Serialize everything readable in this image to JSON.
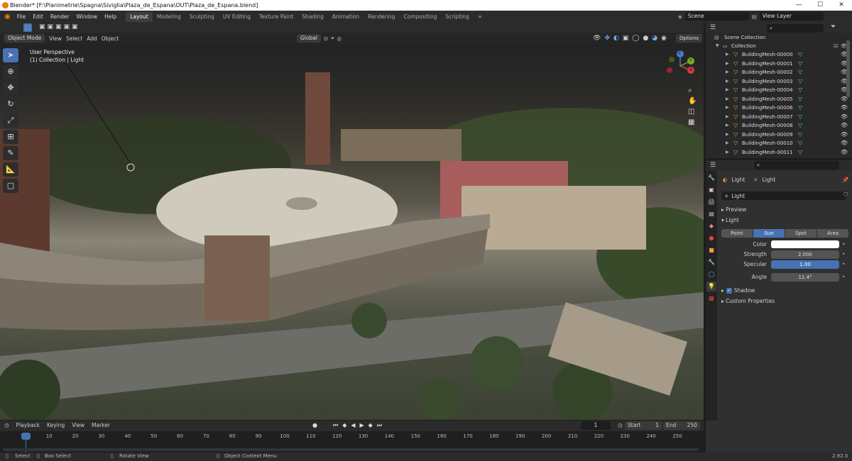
{
  "window": {
    "title": "Blender* [F:\\Planimetrie\\Spagna\\Siviglia\\Plaza_de_Espana\\OUT\\Plaza_de_Espana.blend]",
    "minimize": "—",
    "maximize": "☐",
    "close": "✕"
  },
  "menu": [
    "File",
    "Edit",
    "Render",
    "Window",
    "Help"
  ],
  "workspaces": [
    "Layout",
    "Modeling",
    "Sculpting",
    "UV Editing",
    "Texture Paint",
    "Shading",
    "Animation",
    "Rendering",
    "Compositing",
    "Scripting",
    "+"
  ],
  "scene": {
    "label": "Scene",
    "view_layer": "View Layer"
  },
  "viewport_header": {
    "mode": "Object Mode",
    "items": [
      "View",
      "Select",
      "Add",
      "Object"
    ],
    "orientation": "Global",
    "options": "Options"
  },
  "viewport": {
    "perspective": "User Perspective",
    "context": "(1) Collection | Light"
  },
  "gizmo": {
    "x": "X",
    "y": "Y",
    "z": "Z"
  },
  "outliner": {
    "scene_collection": "Scene Collection",
    "collection": "Collection",
    "items": [
      "BuildingMesh-00000",
      "BuildingMesh-00001",
      "BuildingMesh-00002",
      "BuildingMesh-00003",
      "BuildingMesh-00004",
      "BuildingMesh-00005",
      "BuildingMesh-00006",
      "BuildingMesh-00007",
      "BuildingMesh-00008",
      "BuildingMesh-00009",
      "BuildingMesh-00010",
      "BuildingMesh-00011"
    ]
  },
  "properties": {
    "breadcrumb_obj": "Light",
    "breadcrumb_data": "Light",
    "data_name": "Light",
    "panels": {
      "preview": "Preview",
      "light": "Light",
      "shadow": "Shadow",
      "custom": "Custom Properties"
    },
    "light_types": [
      "Point",
      "Sun",
      "Spot",
      "Area"
    ],
    "active_type": "Sun",
    "color_label": "Color",
    "color_value": "#ffffff",
    "strength_label": "Strength",
    "strength": "2.000",
    "specular_label": "Specular",
    "specular": "1.00",
    "angle_label": "Angle",
    "angle": "11.4°"
  },
  "timeline": {
    "menu": [
      "Playback",
      "Keying",
      "View",
      "Marker"
    ],
    "current_frame": "1",
    "start_label": "Start",
    "start": "1",
    "end_label": "End",
    "end": "250",
    "ticks": [
      "1",
      "10",
      "20",
      "30",
      "40",
      "50",
      "60",
      "70",
      "80",
      "90",
      "100",
      "110",
      "120",
      "130",
      "140",
      "150",
      "160",
      "170",
      "180",
      "190",
      "200",
      "210",
      "220",
      "230",
      "240",
      "250"
    ]
  },
  "status": {
    "select": "Select",
    "box_select": "Box Select",
    "rotate": "Rotate View",
    "context_menu": "Object Context Menu",
    "version": "2.92.0"
  },
  "colors": {
    "accent": "#4772b3",
    "orange": "#e87d0d",
    "mesh_data": "#54d49a"
  }
}
